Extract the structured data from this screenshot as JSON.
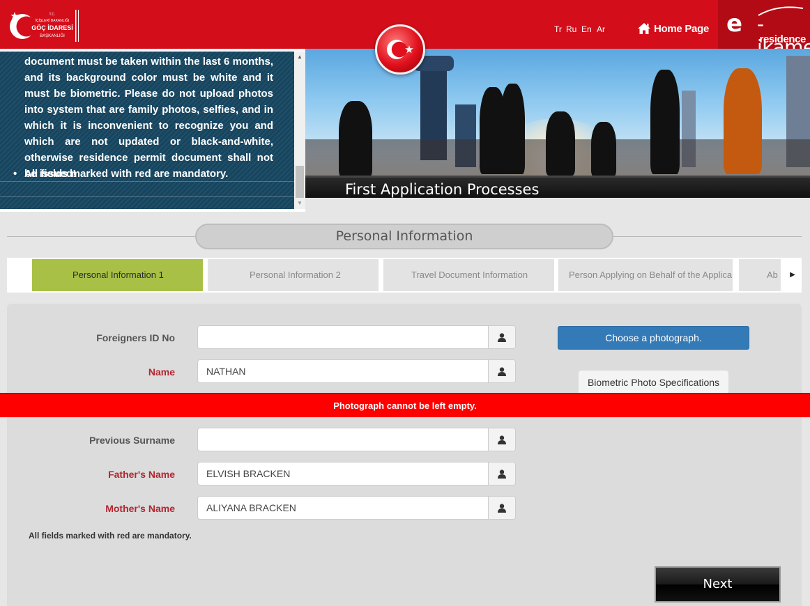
{
  "header": {
    "logo_lines": [
      "T.C.",
      "İÇİŞLERİ BAKANLIĞI",
      "GÖÇ İDARESİ",
      "BAŞKANLIĞI"
    ],
    "languages": [
      "Tr",
      "Ru",
      "En",
      "Ar"
    ],
    "home_label": "Home Page",
    "brand_e": "e",
    "brand_name": "-ikamet",
    "brand_sub": "residence"
  },
  "info_panel": {
    "paragraph": "document must be taken within the last 6 months, and its background color must be white and it must be biometric. Please do not upload photos into system that are family photos, selfies, and in which it is inconvenient to recognize you and which are not updated or black-and-white, otherwise residence permit document shall not be issued!",
    "bullet": "All fields marked with red are mandatory."
  },
  "banner": {
    "caption": "First Application Processes"
  },
  "section": {
    "title": "Personal Information"
  },
  "steps": [
    {
      "label": "Personal Information 1",
      "active": true
    },
    {
      "label": "Personal Information 2",
      "active": false
    },
    {
      "label": "Travel Document Information",
      "active": false
    },
    {
      "label": "Person Applying on Behalf of the Applicant",
      "active": false
    },
    {
      "label": "Ab",
      "active": false
    }
  ],
  "form": {
    "fields": [
      {
        "label": "Foreigners ID No",
        "value": "",
        "required": false
      },
      {
        "label": "Name",
        "value": "NATHAN",
        "required": true
      },
      {
        "label": "Previous Surname",
        "value": "",
        "required": false
      },
      {
        "label": "Father's Name",
        "value": "ELVISH BRACKEN",
        "required": true
      },
      {
        "label": "Mother's Name",
        "value": "ALIYANA BRACKEN",
        "required": true
      }
    ],
    "photo_button": "Choose a photograph.",
    "bio_button": "Biometric Photo Specifications",
    "error": "Photograph cannot be left empty.",
    "mandatory_note": "All fields marked with red are mandatory.",
    "next_label": "Next"
  },
  "colors": {
    "brand_red": "#d30e1a",
    "active_step": "#a8c045",
    "primary_button": "#337ab7",
    "required_label": "#b3262f",
    "error_bar": "#ff0000"
  },
  "icons": [
    "crescent-star-logo-icon",
    "home-icon",
    "user-icon",
    "turkish-flag-icon",
    "chevron-right-icon",
    "scroll-up-icon",
    "scroll-down-icon"
  ]
}
